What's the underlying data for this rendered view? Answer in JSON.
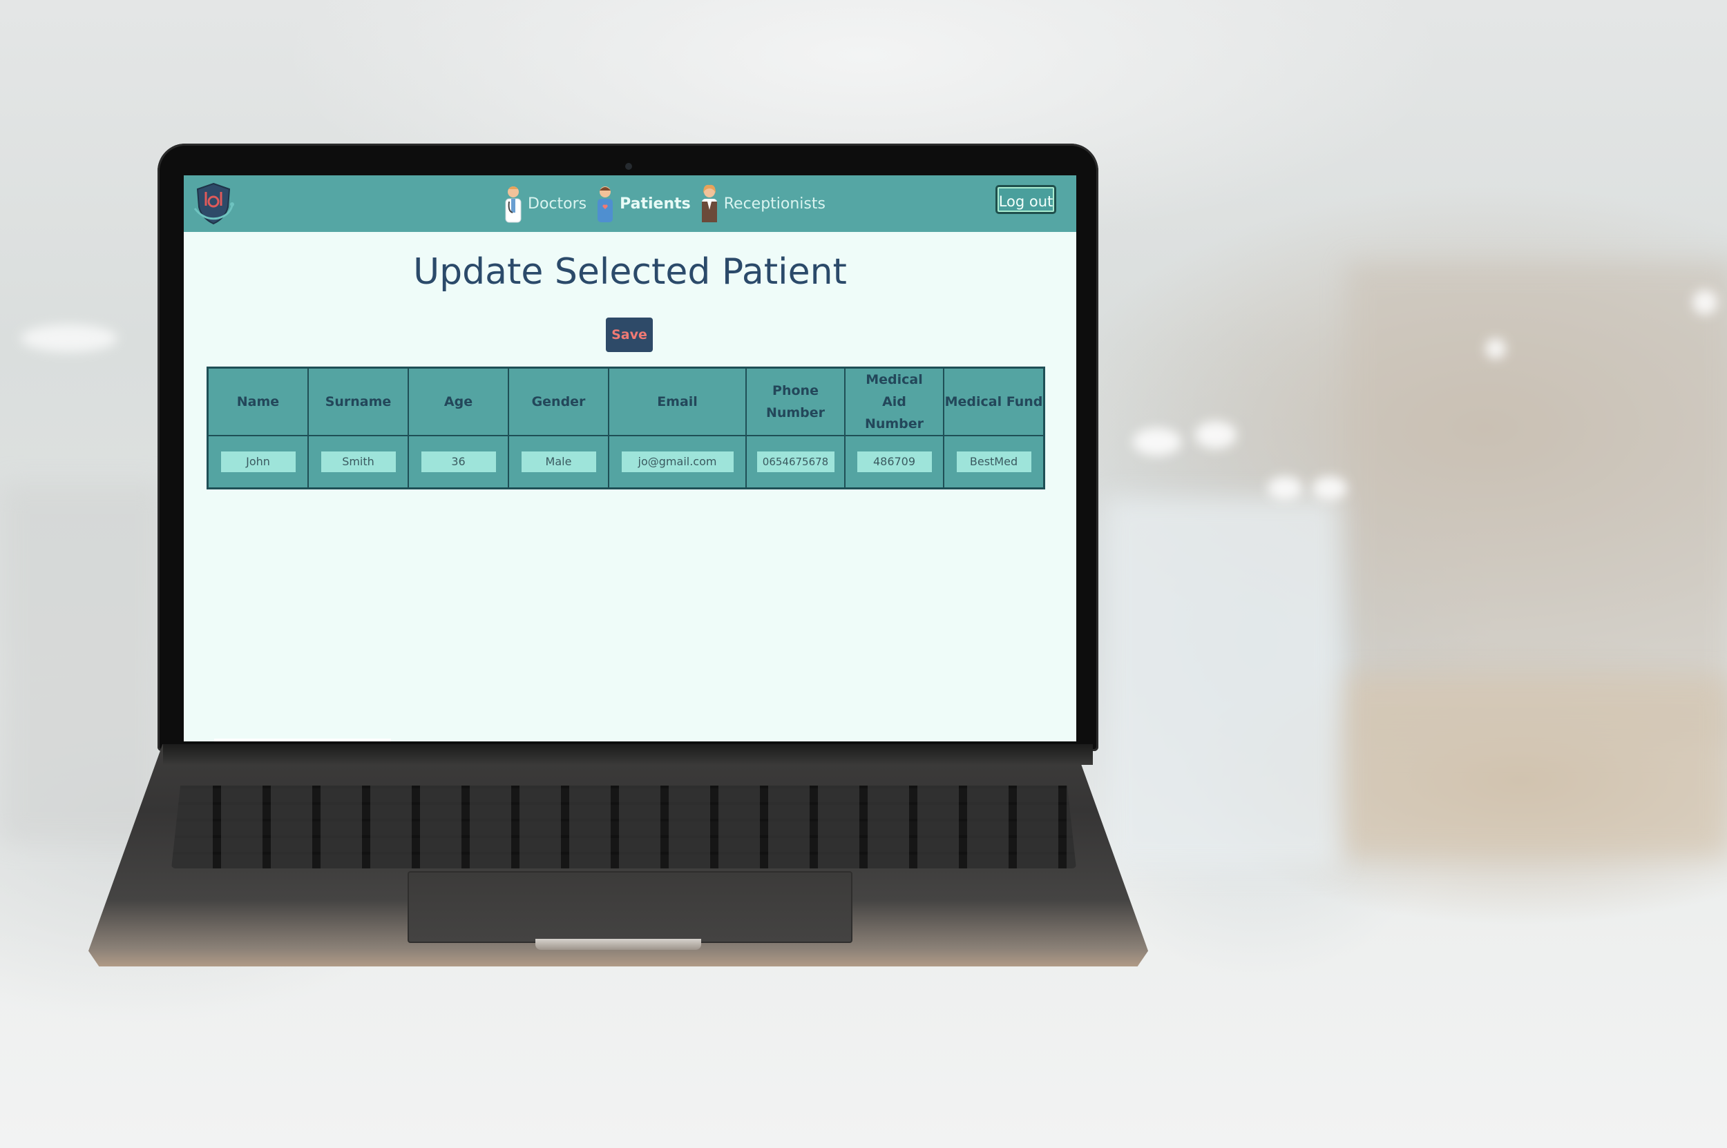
{
  "header": {
    "nav": [
      {
        "label": "Doctors",
        "icon": "doctor-icon",
        "active": false
      },
      {
        "label": "Patients",
        "icon": "patient-icon",
        "active": true
      },
      {
        "label": "Receptionists",
        "icon": "receptionist-icon",
        "active": false
      }
    ],
    "logout_label": "Log out",
    "logo_icon": "medical-shield-logo-icon"
  },
  "main": {
    "title": "Update Selected Patient",
    "save_label": "Save"
  },
  "table": {
    "columns": [
      "Name",
      "Surname",
      "Age",
      "Gender",
      "Email",
      "Phone Number",
      "Medical Aid Number",
      "Medical Fund"
    ],
    "row": {
      "name": "John",
      "surname": "Smith",
      "age": "36",
      "gender": "Male",
      "email": "jo@gmail.com",
      "phone": "0654675678",
      "medical_aid_number": "486709",
      "medical_fund": "BestMed"
    }
  },
  "colors": {
    "header_bg": "#55a6a4",
    "screen_bg": "#effcf9",
    "title": "#2b4a6a",
    "save_bg": "#2e4a68",
    "save_text": "#f07a74",
    "input_bg": "#9ee4da"
  }
}
